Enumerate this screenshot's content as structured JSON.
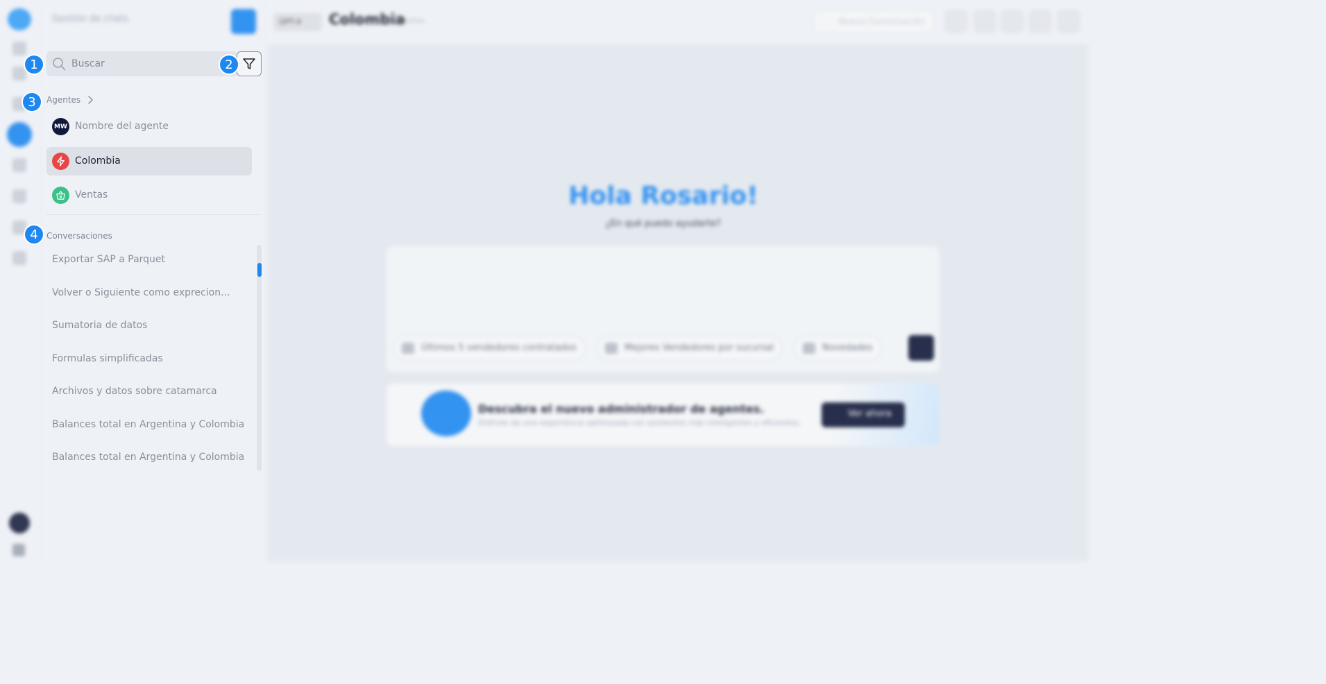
{
  "app": {
    "header_title": "Gestión de chats"
  },
  "topbar": {
    "model_label": "GPT-4",
    "title": "Colombia",
    "subtitle": "Activo",
    "new_conversation_label": "Nueva Conversación"
  },
  "search": {
    "placeholder": "Buscar",
    "value": ""
  },
  "markers": [
    "1",
    "2",
    "3",
    "4"
  ],
  "agents_section": {
    "label": "Agentes",
    "items": [
      {
        "label": "Nombre del agente",
        "avatar_text": "MW",
        "avatar_color": "#11193a"
      },
      {
        "label": "Colombia",
        "icon": "lightning-icon",
        "avatar_color": "#e84545",
        "active": true
      },
      {
        "label": "Ventas",
        "icon": "basket-icon",
        "avatar_color": "#3cc08a"
      }
    ]
  },
  "conversations_section": {
    "label": "Conversaciones",
    "items": [
      "Exportar SAP a Parquet",
      "Volver o Siguiente como exprecion...",
      "Sumatoria de datos",
      "Formulas simplificadas",
      "Archivos y datos sobre catamarca",
      "Balances total en Argentina y Colombia",
      "Balances total en Argentina y Colombia"
    ]
  },
  "main": {
    "greeting": "Hola Rosario!",
    "greeting_sub": "¿En qué puedo ayudarte?",
    "suggestions": [
      "Últimos 5  vendedores contratados",
      "Mejores  Vendedores por sucursal",
      "Novedades"
    ],
    "promo_title": "Descubra el nuevo administrador de agentes.",
    "promo_sub": "Disfrute de una experiencia optimizada con asistentes más inteligentes y eficientes.",
    "promo_button": "Ver ahora"
  },
  "colors": {
    "accent": "#1e88f0",
    "dark": "#11193a",
    "background": "#eef1f6"
  }
}
